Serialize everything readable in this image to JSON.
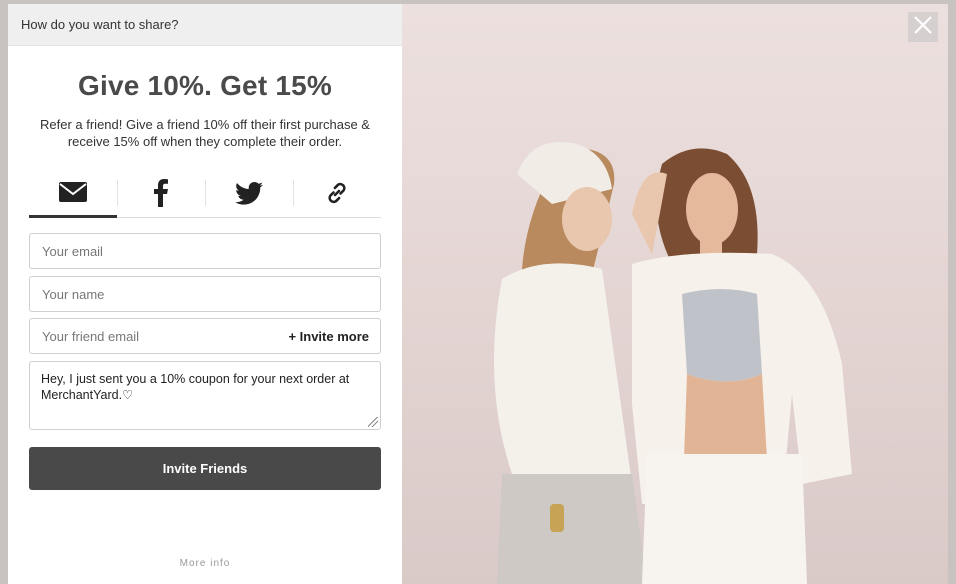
{
  "topbar": {
    "title": "How do you want to share?"
  },
  "headline": "Give 10%. Get 15%",
  "subline": "Refer a friend! Give a friend 10% off their first purchase & receive 15% off when they complete their order.",
  "share_tabs": [
    {
      "icon": "email-icon",
      "active": true
    },
    {
      "icon": "facebook-icon",
      "active": false
    },
    {
      "icon": "twitter-icon",
      "active": false
    },
    {
      "icon": "link-icon",
      "active": false
    }
  ],
  "form": {
    "email_placeholder": "Your email",
    "name_placeholder": "Your name",
    "friend_email_placeholder": "Your friend email",
    "invite_more_label": "+ Invite more",
    "message": "Hey, I just sent you a 10% coupon for your next order at MerchantYard.♡"
  },
  "invite_button_label": "Invite Friends",
  "more_info_label": "More info",
  "colors": {
    "button": "#494949",
    "accent_text": "#4a4a4a",
    "photo_bg": "#e8dcda"
  }
}
